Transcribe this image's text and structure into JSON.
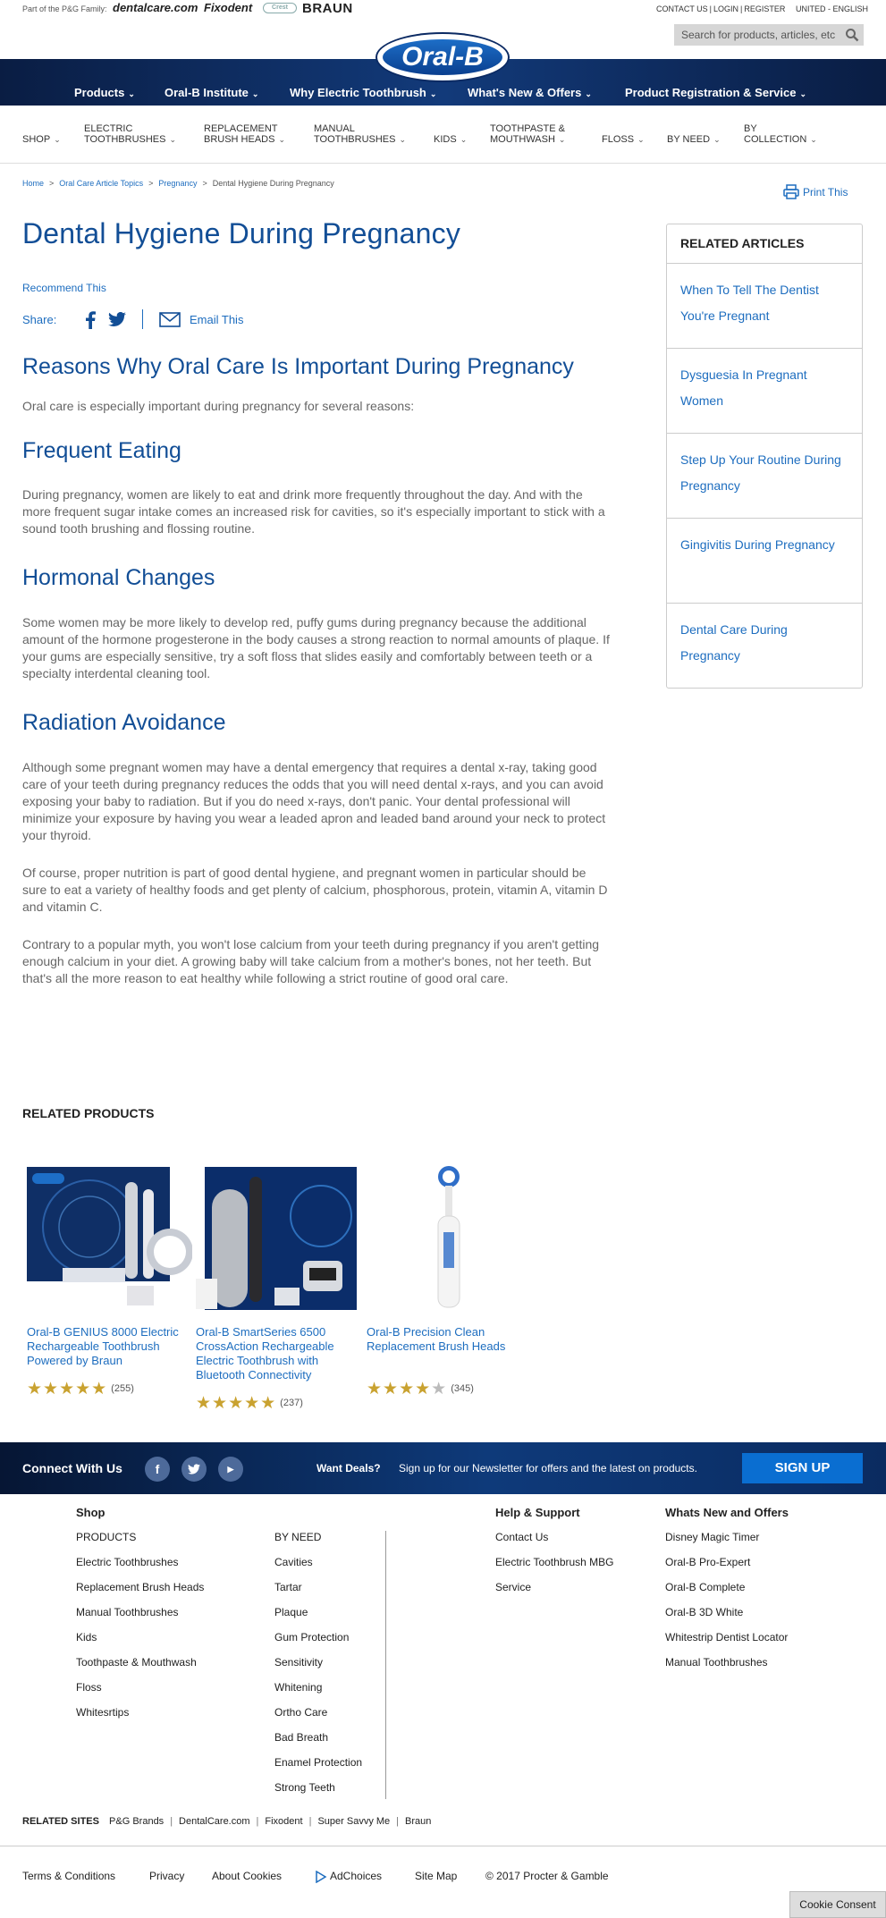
{
  "top": {
    "pg_family": "Part of the P&G Family:",
    "brands": [
      "dentalcare.com",
      "Fixodent",
      "Crest",
      "BRAUN"
    ],
    "links": [
      "CONTACT US",
      "LOGIN",
      "REGISTER"
    ],
    "region": "UNITED - ENGLISH",
    "search_placeholder": "Search for products, articles, etc."
  },
  "logo_text": "Oral-B",
  "main_nav": [
    "Products",
    "Oral-B Institute",
    "Why Electric Toothbrush",
    "What's New & Offers",
    "Product Registration & Service"
  ],
  "sub_nav": [
    [
      "SHOP"
    ],
    [
      "ELECTRIC",
      "TOOTHBRUSHES"
    ],
    [
      "REPLACEMENT",
      "BRUSH HEADS"
    ],
    [
      "MANUAL",
      "TOOTHBRUSHES"
    ],
    [
      "KIDS"
    ],
    [
      "TOOTHPASTE &",
      "MOUTHWASH"
    ],
    [
      "FLOSS"
    ],
    [
      "BY NEED"
    ],
    [
      "BY",
      "COLLECTION"
    ]
  ],
  "breadcrumb": [
    "Home",
    "Oral Care Article Topics",
    "Pregnancy",
    "Dental Hygiene During Pregnancy"
  ],
  "print_label": "Print This",
  "page_title": "Dental Hygiene During Pregnancy",
  "recommend_label": "Recommend This",
  "share": {
    "label": "Share:",
    "email": "Email This"
  },
  "article": {
    "h_reasons": "Reasons Why Oral Care Is Important During Pregnancy",
    "p_intro": "Oral care is especially important during pregnancy for several reasons:",
    "h_eating": "Frequent Eating",
    "p_eating": "During pregnancy, women are likely to eat and drink more frequently throughout the day. And with the more frequent sugar intake comes an increased risk for cavities, so it's especially important to stick with a sound tooth brushing and flossing routine.",
    "h_hormonal": "Hormonal Changes",
    "p_hormonal": "Some women may be more likely to develop red, puffy gums during pregnancy because the additional amount of the hormone progesterone in the body causes a strong reaction to normal amounts of plaque. If your gums are especially sensitive, try a soft floss that slides easily and comfortably between teeth or a specialty interdental cleaning tool.",
    "h_radiation": "Radiation Avoidance",
    "p_radiation": "Although some pregnant women may have a dental emergency that requires a dental x-ray, taking good care of your teeth during pregnancy reduces the odds that you will need dental x-rays, and you can avoid exposing your baby to radiation. But if you do need x-rays, don't panic. Your dental professional will minimize your exposure by having you wear a leaded apron and leaded band around your neck to protect your thyroid.",
    "p_nutrition": "Of course, proper nutrition is part of good dental hygiene, and pregnant women in particular should be sure to eat a variety of healthy foods and get plenty of calcium, phosphorous, protein, vitamin A, vitamin D and vitamin C.",
    "p_myth": "Contrary to a popular myth, you won't lose calcium from your teeth during pregnancy if you aren't getting enough calcium in your diet. A growing baby will take calcium from a mother's bones, not her teeth. But that's all the more reason to eat healthy while following a strict routine of good oral care."
  },
  "related_articles": {
    "title": "RELATED ARTICLES",
    "items": [
      "When To Tell The Dentist You're Pregnant",
      "Dysguesia In Pregnant Women",
      "Step Up Your Routine During Pregnancy",
      "Gingivitis During Pregnancy",
      "Dental Care During Pregnancy"
    ]
  },
  "related_products": {
    "title": "RELATED PRODUCTS",
    "items": [
      {
        "name": "Oral-B GENIUS 8000 Electric Rechargeable Toothbrush Powered by Braun",
        "stars": 5,
        "count": "(255)"
      },
      {
        "name": "Oral-B SmartSeries 6500 CrossAction Rechargeable Electric Toothbrush with Bluetooth Connectivity",
        "stars": 5,
        "count": "(237)"
      },
      {
        "name": "Oral-B Precision Clean Replacement Brush Heads",
        "stars": 4,
        "count": "(345)"
      }
    ]
  },
  "connect": {
    "title": "Connect With Us",
    "deals": "Want Deals?",
    "deals_text": "Sign up for our Newsletter for offers and the latest on products.",
    "signup": "SIGN UP"
  },
  "footer": {
    "shop_title": "Shop",
    "shop_col1": [
      "PRODUCTS",
      "Electric Toothbrushes",
      "Replacement Brush Heads",
      "Manual Toothbrushes",
      "Kids",
      "Toothpaste & Mouthwash",
      "Floss",
      "Whitesrtips"
    ],
    "shop_col2": [
      "BY NEED",
      "Cavities",
      "Tartar",
      "Plaque",
      "Gum Protection",
      "Sensitivity",
      "Whitening",
      "Ortho Care",
      "Bad Breath",
      "Enamel Protection",
      "Strong Teeth"
    ],
    "help_title": "Help & Support",
    "help": [
      "Contact Us",
      "Electric Toothbrush MBG",
      "Service"
    ],
    "news_title": "Whats New and Offers",
    "news": [
      "Disney Magic Timer",
      "Oral-B Pro-Expert",
      "Oral-B Complete",
      "Oral-B 3D White",
      "Whitestrip Dentist Locator",
      "Manual Toothbrushes"
    ],
    "related_sites_label": "RELATED SITES",
    "related_sites": [
      "P&G Brands",
      "DentalCare.com",
      "Fixodent",
      "Super Savvy Me",
      "Braun"
    ],
    "legal": [
      "Terms & Conditions",
      "Privacy",
      "About Cookies",
      "AdChoices",
      "Site Map",
      "© 2017 Procter & Gamble"
    ],
    "cookie": "Cookie Consent"
  },
  "colors": {
    "heading_blue": "#124e96",
    "link_blue": "#1d6dbf",
    "nav_dark": "#0a1d43",
    "star_gold": "#c9a230"
  }
}
